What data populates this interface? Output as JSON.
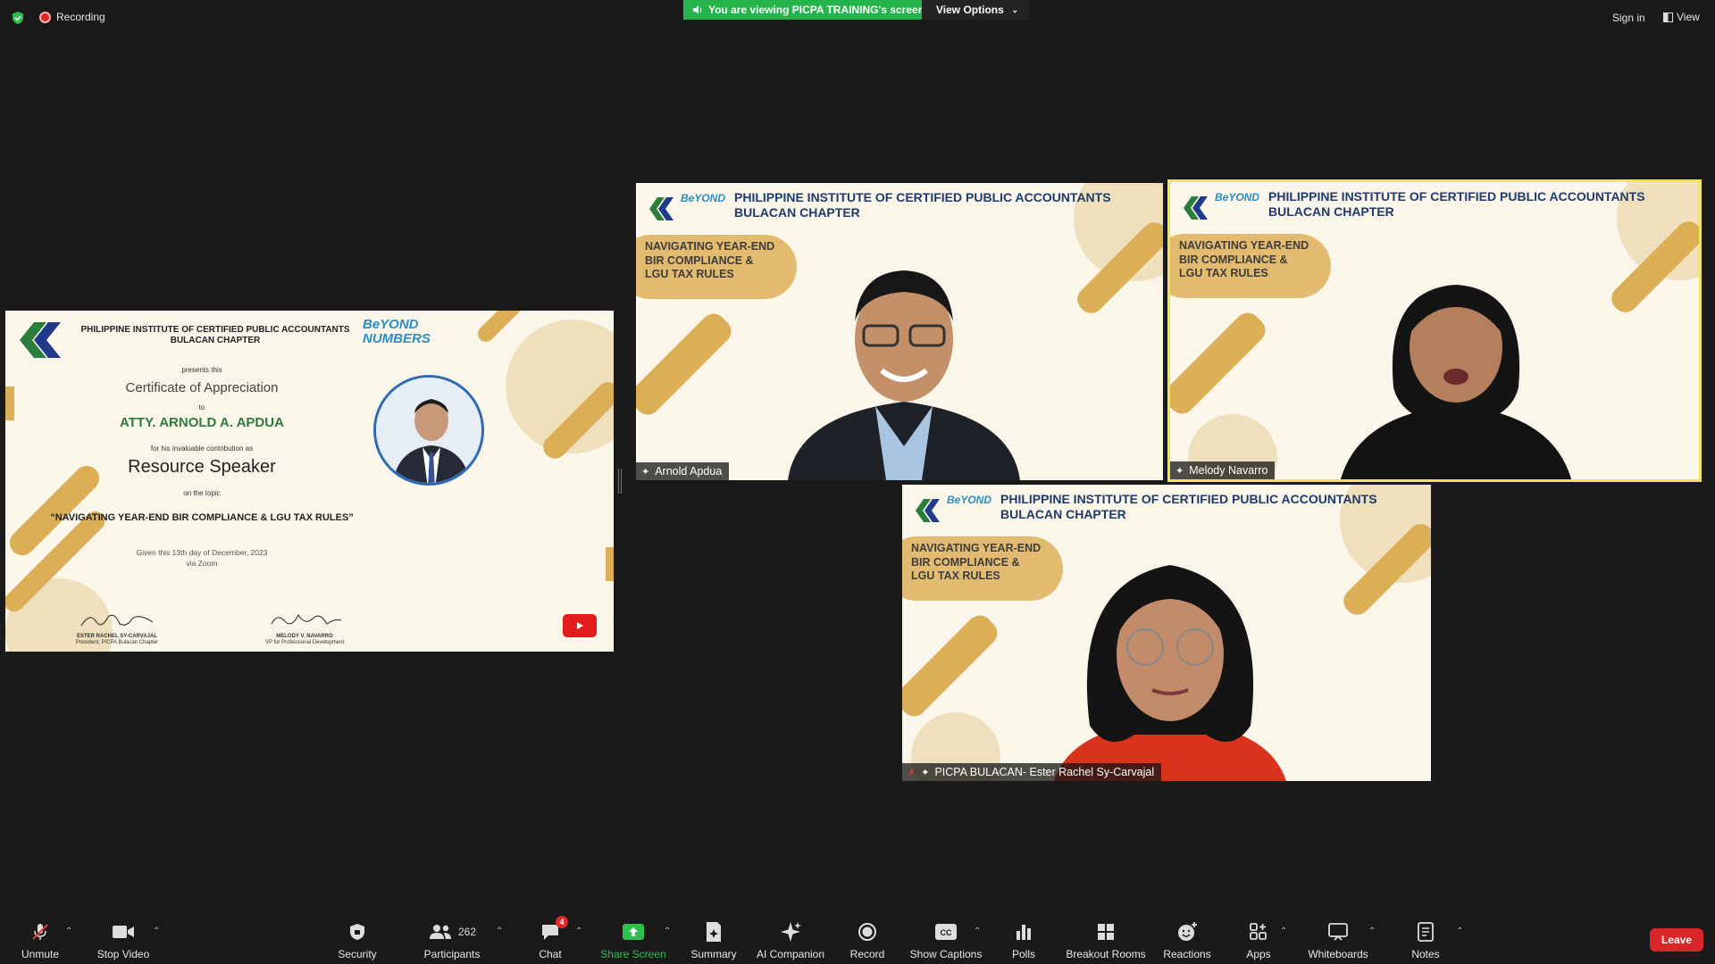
{
  "top_bar": {
    "recording_label": "Recording",
    "viewing_banner": "You are viewing PICPA TRAINING's screen",
    "view_options_label": "View Options",
    "sign_in_label": "Sign in",
    "view_label": "View"
  },
  "shared_screen": {
    "org_line1": "PHILIPPINE INSTITUTE OF CERTIFIED PUBLIC ACCOUNTANTS",
    "org_line2": "BULACAN CHAPTER",
    "logo_text": "BeYOND NUMBERS",
    "presents": "presents this",
    "cert_title": "Certificate of Appreciation",
    "to": "to",
    "recipient": "ATTY. ARNOLD A. APDUA",
    "contribution": "for his invaluable contribution as",
    "role": "Resource Speaker",
    "on_topic": "on the topic",
    "topic": "“NAVIGATING YEAR-END BIR COMPLIANCE & LGU TAX RULES”",
    "given": "Given this 13th day of December, 2023",
    "via": "via Zoom",
    "sig1_name": "ESTER RACHEL SY-CARVAJAL",
    "sig1_title": "President, PICPA Bulacan Chapter",
    "sig2_name": "MELODY V. NAVARRO",
    "sig2_title": "VP for Professional Development"
  },
  "tiles": [
    {
      "org_line1": "PHILIPPINE INSTITUTE OF CERTIFIED PUBLIC ACCOUNTANTS",
      "org_line2": "BULACAN CHAPTER",
      "topic_line1": "NAVIGATING YEAR-END",
      "topic_line2": "BIR COMPLIANCE &",
      "topic_line3": "LGU TAX RULES",
      "name": "Arnold Apdua"
    },
    {
      "org_line1": "PHILIPPINE INSTITUTE OF CERTIFIED PUBLIC ACCOUNTANTS",
      "org_line2": "BULACAN CHAPTER",
      "topic_line1": "NAVIGATING YEAR-END",
      "topic_line2": "BIR COMPLIANCE &",
      "topic_line3": "LGU TAX RULES",
      "name": "Melody Navarro"
    },
    {
      "org_line1": "PHILIPPINE INSTITUTE OF CERTIFIED PUBLIC ACCOUNTANTS",
      "org_line2": "BULACAN CHAPTER",
      "topic_line1": "NAVIGATING YEAR-END",
      "topic_line2": "BIR COMPLIANCE &",
      "topic_line3": "LGU TAX RULES",
      "name": "PICPA BULACAN- Ester Rachel Sy-Carvajal"
    }
  ],
  "toolbar": {
    "unmute": "Unmute",
    "stop_video": "Stop Video",
    "security": "Security",
    "participants": "Participants",
    "participants_count": "262",
    "chat": "Chat",
    "chat_badge": "4",
    "share_screen": "Share Screen",
    "summary": "Summary",
    "ai_companion": "AI Companion",
    "record": "Record",
    "show_captions": "Show Captions",
    "polls": "Polls",
    "breakout_rooms": "Breakout Rooms",
    "reactions": "Reactions",
    "apps": "Apps",
    "whiteboards": "Whiteboards",
    "notes": "Notes",
    "leave": "Leave"
  },
  "colors": {
    "background": "#1a1a1a",
    "banner_green": "#25b34b",
    "leave_red": "#d9262b",
    "speaker_highlight": "#f0e25a",
    "slide_bg": "#fbf6ea",
    "accent_gold": "#dcae55"
  }
}
